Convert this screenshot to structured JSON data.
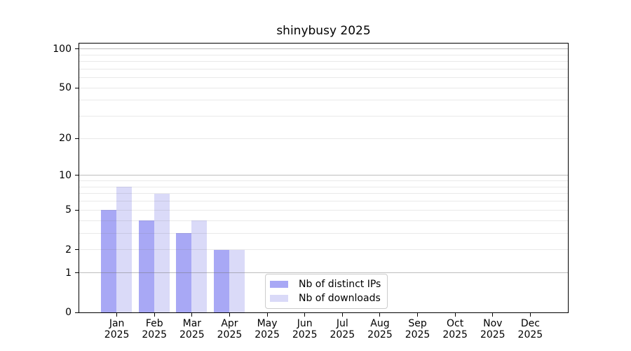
{
  "title": "shinybusy 2025",
  "chart_data": {
    "type": "bar",
    "title": "shinybusy 2025",
    "x": {
      "categories": [
        "Jan",
        "Feb",
        "Mar",
        "Apr",
        "May",
        "Jun",
        "Jul",
        "Aug",
        "Sep",
        "Oct",
        "Nov",
        "Dec"
      ],
      "year_label": "2025"
    },
    "series": [
      {
        "name": "Nb of distinct IPs",
        "color": "#a8a8f5",
        "values": [
          5,
          4,
          3,
          2,
          0,
          0,
          0,
          0,
          0,
          0,
          0,
          0
        ]
      },
      {
        "name": "Nb of downloads",
        "color": "#dadaf8",
        "values": [
          8,
          7,
          4,
          2,
          0,
          0,
          0,
          0,
          0,
          0,
          0,
          0
        ]
      }
    ],
    "y_axis": {
      "scale": "log1p",
      "max": 110,
      "tick_values": [
        0,
        1,
        2,
        5,
        10,
        20,
        50,
        100
      ],
      "tick_labels": [
        "0",
        "1",
        "2",
        "5",
        "10",
        "20",
        "50",
        "100"
      ],
      "major_gridlines": [
        1,
        10,
        100
      ],
      "minor_gridlines": [
        2,
        3,
        4,
        5,
        6,
        7,
        8,
        9,
        20,
        30,
        40,
        50,
        60,
        70,
        80,
        90
      ]
    },
    "legend_position": "bottom-center-left",
    "grid": "on"
  },
  "colors": {
    "background": "#ffffff",
    "spine": "#000000",
    "text": "#000000",
    "grid_major": "rgba(110,110,110,0.45)",
    "grid_minor": "rgba(110,110,110,0.15)",
    "legend_border": "#cccccc"
  }
}
